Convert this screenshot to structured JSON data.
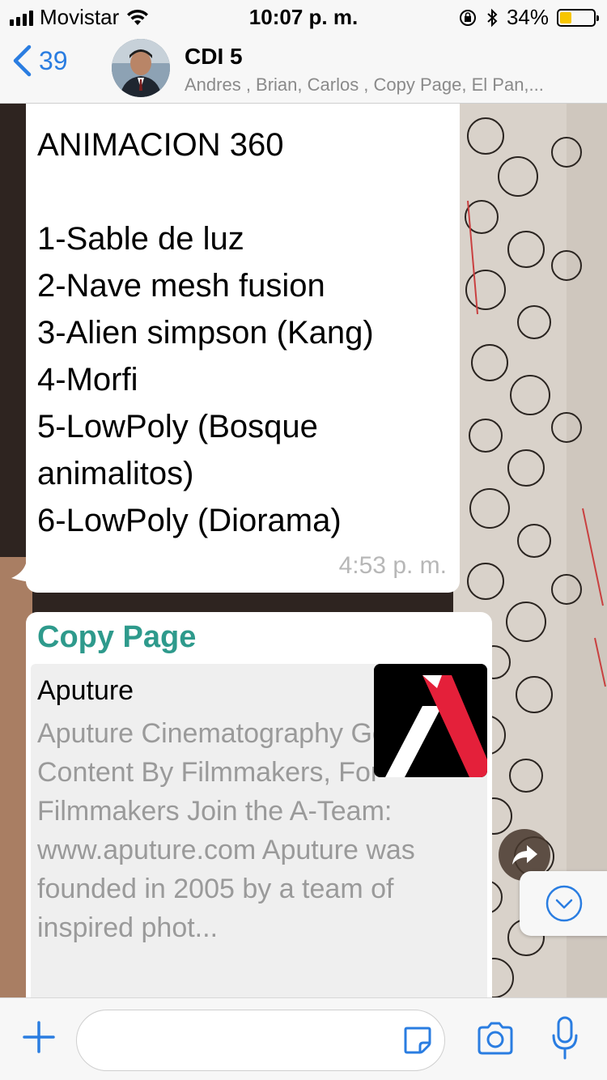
{
  "status": {
    "carrier": "Movistar",
    "time": "10:07 p. m.",
    "battery": "34%",
    "battery_level": 0.34
  },
  "header": {
    "back_count": "39",
    "title": "CDI 5",
    "participants": "Andres , Brian, Carlos , Copy Page, El Pan,..."
  },
  "messages": {
    "first": {
      "title": "ANIMACION 360",
      "items": [
        "1-Sable de luz",
        "2-Nave mesh fusion",
        "3-Alien simpson (Kang)",
        "4-Morfi",
        "5-LowPoly (Bosque",
        "animalitos)",
        "6-LowPoly (Diorama)"
      ],
      "time": "4:53 p. m."
    },
    "second": {
      "sender": "Copy Page",
      "preview_title": "Aputure",
      "preview_description": "Aputure Cinematography Gear and Content By Filmmakers, For Filmmakers Join the A-Team: www.aputure.com Aputure was founded in 2005 by a team of inspired phot..."
    }
  },
  "input": {
    "placeholder": ""
  },
  "icons": {
    "back": "chevron-left-icon",
    "plus": "plus-icon",
    "sticker": "sticker-icon",
    "camera": "camera-icon",
    "mic": "microphone-icon",
    "share": "forward-icon",
    "scroll": "chevron-down-circle-icon"
  },
  "colors": {
    "accent": "#2a7de1",
    "sender": "#2e9a8c",
    "battery": "#f7c600"
  }
}
